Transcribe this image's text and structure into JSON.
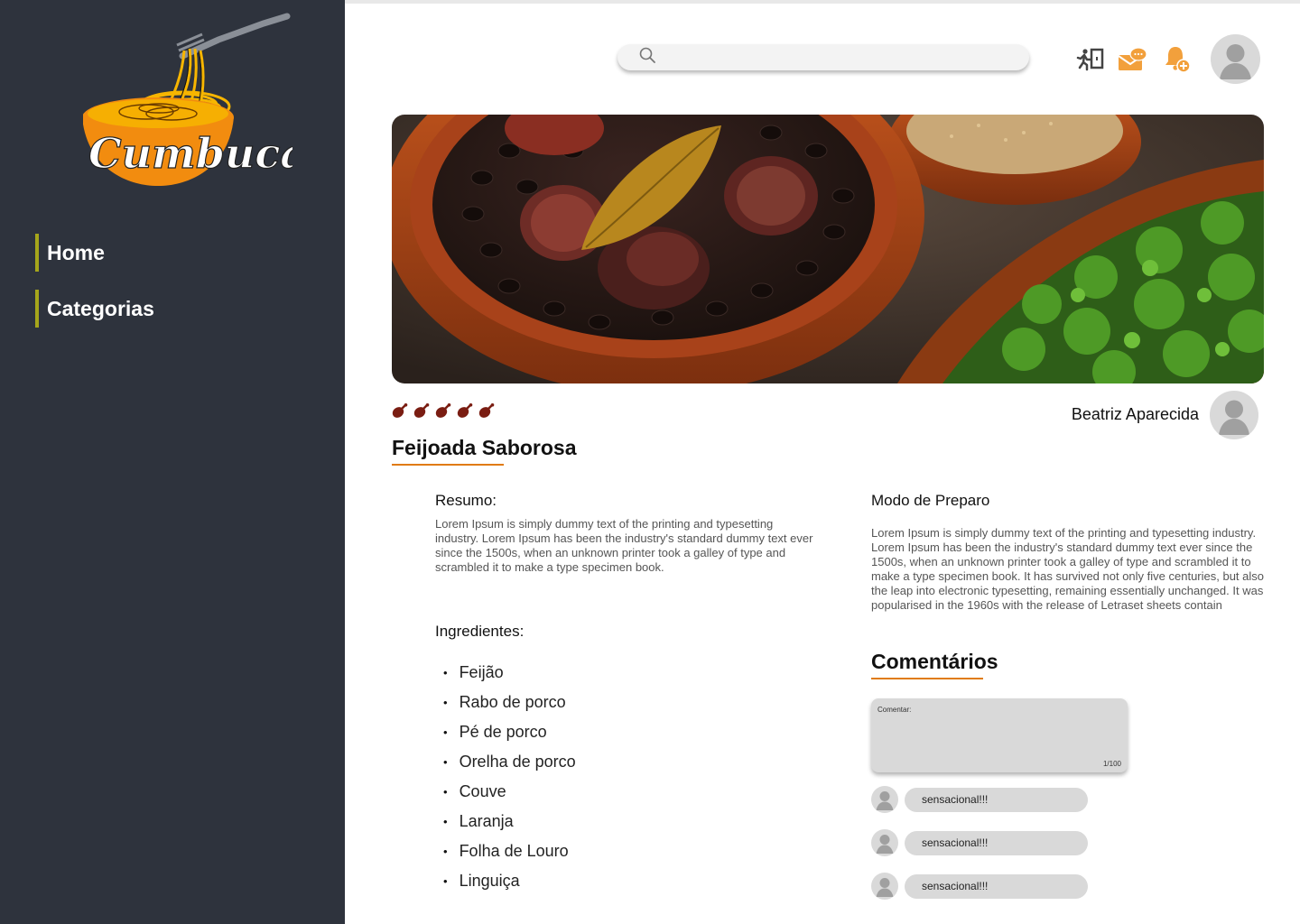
{
  "brand": {
    "logo_text": "Cumbuca",
    "accent": "#e07b10",
    "sidebar_bg": "#2e333d",
    "nav_marker": "#a6a61b"
  },
  "nav": {
    "items": [
      {
        "label": "Home"
      },
      {
        "label": "Categorias"
      }
    ]
  },
  "header": {
    "search": {
      "placeholder": ""
    },
    "icons": [
      "exit-icon",
      "messages-icon",
      "notification-add-icon",
      "user-avatar"
    ]
  },
  "recipe": {
    "title": "Feijoada Saborosa",
    "rating": 5,
    "rating_max": 5,
    "author": "Beatriz Aparecida",
    "summary_label": "Resumo:",
    "summary_text": "Lorem Ipsum is simply dummy text of the printing and typesetting industry. Lorem Ipsum has been the industry's standard dummy text ever since the 1500s, when an unknown printer took a galley of type and scrambled it to make a type specimen book.",
    "ingredients_label": "Ingredientes:",
    "ingredients": [
      "Feijão",
      "Rabo de porco",
      "Pé de porco",
      "Orelha de porco",
      "Couve",
      "Laranja",
      "Folha de Louro",
      "Linguiça"
    ],
    "preparation_label": "Modo de Preparo",
    "preparation_text": "Lorem Ipsum is simply dummy text of the printing and typesetting industry. Lorem Ipsum has been the industry's standard dummy text ever since the 1500s, when an unknown printer took a galley of type and scrambled it to make a type specimen book. It has survived not only five centuries, but also the leap into electronic typesetting, remaining essentially unchanged. It was popularised in the 1960s with the release of Letraset sheets contain"
  },
  "comments": {
    "title": "Comentários",
    "input_label": "Comentar:",
    "counter": "1/100",
    "items": [
      {
        "text": "sensacional!!!"
      },
      {
        "text": "sensacional!!!"
      },
      {
        "text": "sensacional!!!"
      }
    ]
  }
}
